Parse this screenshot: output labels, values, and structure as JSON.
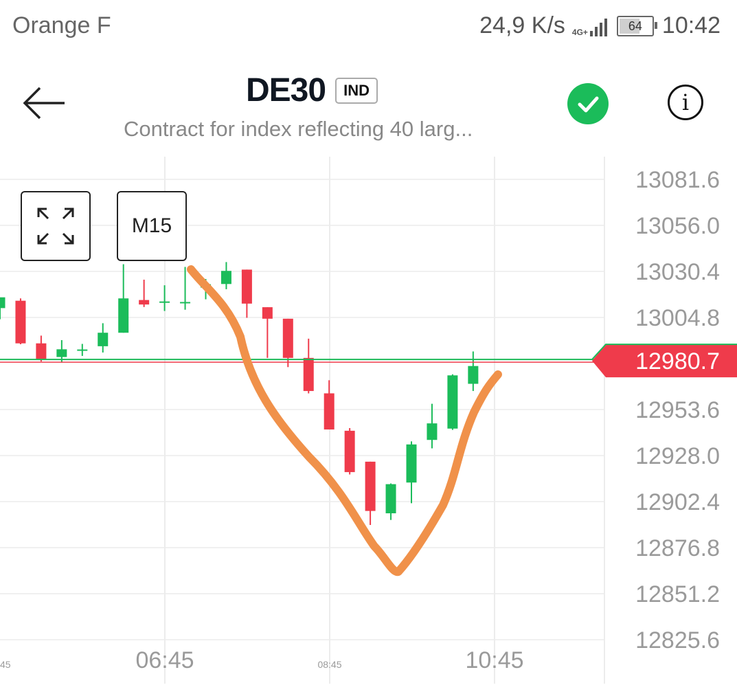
{
  "status_bar": {
    "carrier": "Orange F",
    "speed": "24,9 K/s",
    "network": "4G+",
    "battery": "64",
    "time": "10:42"
  },
  "header": {
    "symbol": "DE30",
    "badge": "IND",
    "subtitle": "Contract for index reflecting 40 larg..."
  },
  "controls": {
    "timeframe": "M15"
  },
  "colors": {
    "up": "#1bbc5a",
    "down": "#ef3b4b",
    "annotation": "#f0914a",
    "check": "#1bbc5a"
  },
  "chart_data": {
    "type": "candlestick",
    "y_ticks": [
      "13081.6",
      "13056.0",
      "13030.4",
      "13004.8",
      "12953.6",
      "12928.0",
      "12902.4",
      "12876.8",
      "12851.2",
      "12825.6"
    ],
    "current_price": "12980.7",
    "x_ticks": [
      "45",
      "06:45",
      "08:45",
      "10:45"
    ],
    "candles": [
      {
        "o": 13010.0,
        "h": 13015.3,
        "l": 13003.8,
        "c": 13016.0
      },
      {
        "o": 13014.1,
        "h": 13015.4,
        "l": 12989.9,
        "c": 12990.4
      },
      {
        "o": 12990.4,
        "h": 12994.7,
        "l": 12980.3,
        "c": 12981.7
      },
      {
        "o": 12982.8,
        "h": 12992.2,
        "l": 12979.7,
        "c": 12987.1
      },
      {
        "o": 12986.8,
        "h": 12990.1,
        "l": 12983.4,
        "c": 12987.0
      },
      {
        "o": 12988.8,
        "h": 13001.6,
        "l": 12985.3,
        "c": 12996.3
      },
      {
        "o": 12996.3,
        "h": 13034.4,
        "l": 12996.3,
        "c": 13015.4
      },
      {
        "o": 13014.5,
        "h": 13025.8,
        "l": 13010.6,
        "c": 13012.0
      },
      {
        "o": 13013.6,
        "h": 13022.7,
        "l": 13008.4,
        "c": 13013.7
      },
      {
        "o": 13012.8,
        "h": 13032.9,
        "l": 13009.1,
        "c": 13013.4
      },
      {
        "o": 13021.4,
        "h": 13026.2,
        "l": 13014.9,
        "c": 13023.3
      },
      {
        "o": 13023.4,
        "h": 13035.6,
        "l": 13020.5,
        "c": 13030.7
      },
      {
        "o": 13031.4,
        "h": 13031.4,
        "l": 13004.6,
        "c": 13012.5
      },
      {
        "o": 13010.5,
        "h": 13010.5,
        "l": 12982.3,
        "c": 13004.1
      },
      {
        "o": 13004.1,
        "h": 13004.1,
        "l": 12977.2,
        "c": 12982.3
      },
      {
        "o": 12982.3,
        "h": 12993.0,
        "l": 12962.6,
        "c": 12963.9
      },
      {
        "o": 12962.6,
        "h": 12969.9,
        "l": 12943.1,
        "c": 12942.5
      },
      {
        "o": 12941.8,
        "h": 12943.3,
        "l": 12917.5,
        "c": 12918.8
      },
      {
        "o": 12924.6,
        "h": 12924.6,
        "l": 12889.4,
        "c": 12897.2
      },
      {
        "o": 12895.9,
        "h": 12912.5,
        "l": 12892.2,
        "c": 12912.1
      },
      {
        "o": 12913.0,
        "h": 12935.9,
        "l": 12901.5,
        "c": 12934.2
      },
      {
        "o": 12936.7,
        "h": 12956.8,
        "l": 12932.0,
        "c": 12945.9
      },
      {
        "o": 12943.0,
        "h": 12973.2,
        "l": 12942.3,
        "c": 12972.6
      },
      {
        "o": 12967.9,
        "h": 12985.9,
        "l": 12963.9,
        "c": 12977.8
      }
    ]
  }
}
